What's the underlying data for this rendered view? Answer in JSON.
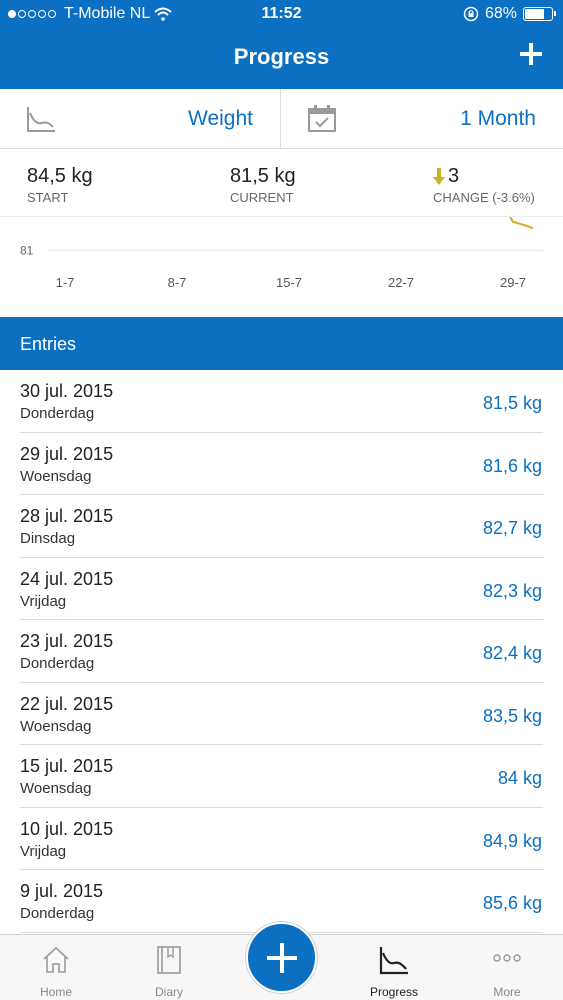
{
  "status_bar": {
    "carrier": "T-Mobile NL",
    "time": "11:52",
    "battery": "68%",
    "battery_level": 0.68
  },
  "header": {
    "title": "Progress"
  },
  "selector": {
    "metric": "Weight",
    "period": "1 Month"
  },
  "stats": {
    "start_value": "84,5 kg",
    "start_label": "START",
    "current_value": "81,5 kg",
    "current_label": "CURRENT",
    "change_value": "3",
    "change_label": "CHANGE (-3.6%)"
  },
  "chart_data": {
    "type": "line",
    "y_tick_labels": [
      "81"
    ],
    "x_tick_labels": [
      "1-7",
      "8-7",
      "15-7",
      "22-7",
      "29-7"
    ],
    "visible_y_range": [
      80.9,
      81.7
    ],
    "series": [
      {
        "x": [
          "29-7",
          "30-7"
        ],
        "values": [
          81.6,
          81.5
        ]
      }
    ]
  },
  "section": {
    "title": "Entries"
  },
  "entries": [
    {
      "date": "30 jul. 2015",
      "day": "Donderdag",
      "weight": "81,5 kg"
    },
    {
      "date": "29 jul. 2015",
      "day": "Woensdag",
      "weight": "81,6 kg"
    },
    {
      "date": "28 jul. 2015",
      "day": "Dinsdag",
      "weight": "82,7 kg"
    },
    {
      "date": "24 jul. 2015",
      "day": "Vrijdag",
      "weight": "82,3 kg"
    },
    {
      "date": "23 jul. 2015",
      "day": "Donderdag",
      "weight": "82,4 kg"
    },
    {
      "date": "22 jul. 2015",
      "day": "Woensdag",
      "weight": "83,5 kg"
    },
    {
      "date": "15 jul. 2015",
      "day": "Woensdag",
      "weight": "84 kg"
    },
    {
      "date": "10 jul. 2015",
      "day": "Vrijdag",
      "weight": "84,9 kg"
    },
    {
      "date": "9 jul. 2015",
      "day": "Donderdag",
      "weight": "85,6 kg"
    }
  ],
  "tabbar": {
    "home": "Home",
    "diary": "Diary",
    "progress": "Progress",
    "more": "More"
  },
  "colors": {
    "accent": "#0b6fc2",
    "chart_line": "#c9b227"
  }
}
